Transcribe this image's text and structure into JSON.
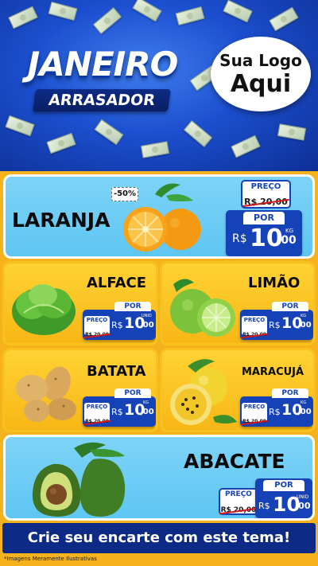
{
  "header": {
    "title": "JANEIRO",
    "subtitle": "ARRASADOR",
    "logo_line1": "Sua Logo",
    "logo_line2": "Aqui"
  },
  "products": {
    "laranja": {
      "name": "LARANJA",
      "discount": "-50%",
      "old_label": "PREÇO",
      "old_price": "R$ 20,00",
      "por": "POR",
      "currency": "R$",
      "price_int": "10",
      "price_dec": ",00",
      "unit": "KG"
    },
    "alface": {
      "name": "ALFACE",
      "old_label": "PREÇO",
      "old_price": "R$ 20,00",
      "por": "POR",
      "currency": "R$",
      "price_int": "10",
      "price_dec": ",00",
      "unit": "UNID"
    },
    "limao": {
      "name": "LIMÃO",
      "old_label": "PREÇO",
      "old_price": "R$ 20,00",
      "por": "POR",
      "currency": "R$",
      "price_int": "10",
      "price_dec": ",00",
      "unit": "KG"
    },
    "batata": {
      "name": "BATATA",
      "old_label": "PREÇO",
      "old_price": "R$ 20,00",
      "por": "POR",
      "currency": "R$",
      "price_int": "10",
      "price_dec": ",00",
      "unit": "KG"
    },
    "maracuja": {
      "name": "MARACUJÁ",
      "old_label": "PREÇO",
      "old_price": "R$ 20,00",
      "por": "POR",
      "currency": "R$",
      "price_int": "10",
      "price_dec": ",00",
      "unit": "KG"
    },
    "abacate": {
      "name": "ABACATE",
      "old_label": "PREÇO",
      "old_price": "R$ 20,00",
      "por": "POR",
      "currency": "R$",
      "price_int": "10",
      "price_dec": ",00",
      "unit": "UNID"
    }
  },
  "footer": {
    "cta": "Crie seu encarte com este tema!",
    "disclaimer": "*Imagens Meramente Ilustrativas"
  },
  "colors": {
    "header_blue": "#1c4fcf",
    "price_blue": "#1642b8",
    "panel_yellow": "#f7b716",
    "panel_light_blue": "#5ec6f3",
    "strike_red": "#d01818"
  },
  "icons": [
    "orange-image",
    "lettuce-image",
    "lime-image",
    "potato-image",
    "passion-fruit-image",
    "avocado-image",
    "money-bill-icon"
  ]
}
